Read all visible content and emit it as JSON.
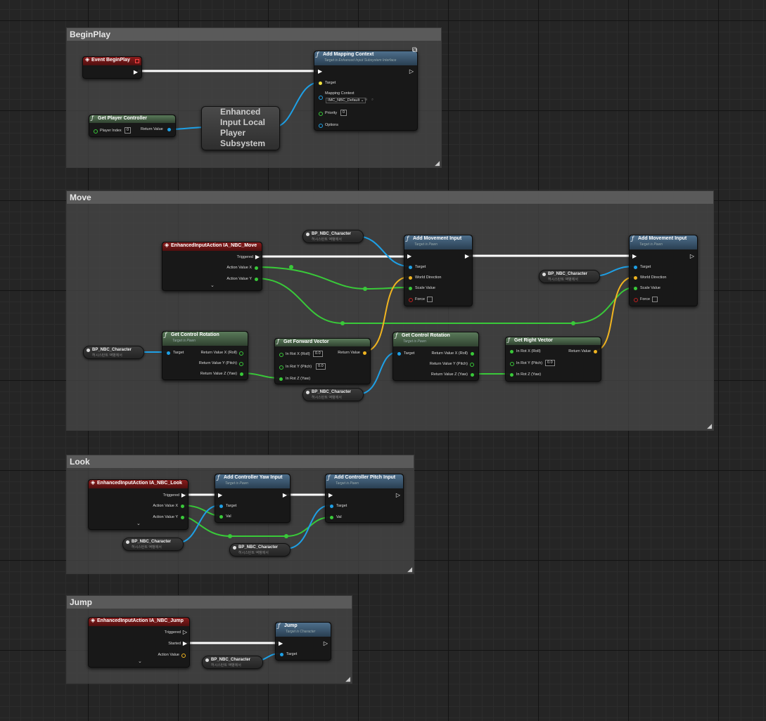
{
  "colors": {
    "exec": "#ffffff",
    "object": "#1ea0e6",
    "float": "#39c939",
    "struct": "#f0b420",
    "bool": "#c02020",
    "background": "#252525"
  },
  "icons": {
    "function": "function-icon",
    "event": "event-diamond-icon",
    "viewport": "viewport-icon"
  },
  "comments": {
    "beginplay": "BeginPlay",
    "move": "Move",
    "look": "Look",
    "jump": "Jump"
  },
  "begin": {
    "event": "Event BeginPlay",
    "amc_title": "Add Mapping Context",
    "amc_sub": "Target is Enhanced Input Subsystem Interface",
    "target": "Target",
    "mapping_context": "Mapping Context",
    "mapping_value": "IMC_NBC_Default",
    "priority": "Priority",
    "priority_value": "0",
    "options": "Options",
    "gpc_title": "Get Player Controller",
    "player_index": "Player Index",
    "player_index_value": "0",
    "return_value": "Return Value",
    "subsystem": "Enhanced Input Local Player Subsystem"
  },
  "move": {
    "event": "EnhancedInputAction IA_NBC_Move",
    "triggered": "Triggered",
    "avx": "Action Value X",
    "avy": "Action Value Y",
    "ami_title": "Add Movement Input",
    "ami_sub": "Target is Pawn",
    "target": "Target",
    "world_direction": "World Direction",
    "scale_value": "Scale Value",
    "force": "Force",
    "gcr_title": "Get Control Rotation",
    "gcr_sub": "Target is Pawn",
    "rvx": "Return Value X (Roll)",
    "rvy": "Return Value Y (Pitch)",
    "rvz": "Return Value Z (Yaw)",
    "gfv_title": "Get Forward Vector",
    "grv_title": "Get Right Vector",
    "in_roll": "In Rot X (Roll)",
    "in_pitch": "In Rot Y (Pitch)",
    "in_yaw": "In Rot Z (Yaw)",
    "zero": "0.0",
    "return_value": "Return Value"
  },
  "look": {
    "event": "EnhancedInputAction IA_NBC_Look",
    "triggered": "Triggered",
    "avx": "Action Value X",
    "avy": "Action Value Y",
    "yaw_title": "Add Controller Yaw Input",
    "pitch_title": "Add Controller Pitch Input",
    "sub": "Target is Pawn",
    "target": "Target",
    "val": "Val"
  },
  "jump": {
    "event": "EnhancedInputAction IA_NBC_Jump",
    "triggered": "Triggered",
    "started": "Started",
    "action_value": "Action Value",
    "jump_title": "Jump",
    "jump_sub": "Target is Character",
    "target": "Target"
  },
  "self_ref": {
    "label": "BP_NBC_Character",
    "sub": "허시스탄트 액뱅에서"
  }
}
